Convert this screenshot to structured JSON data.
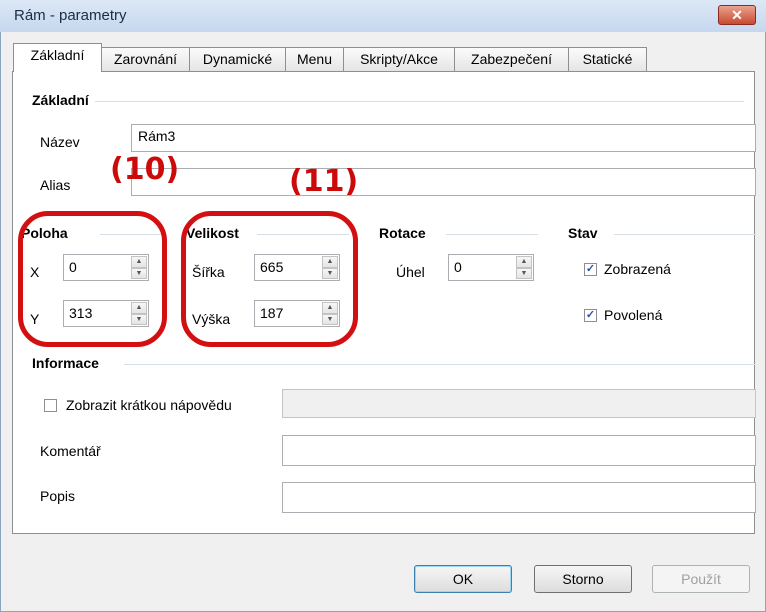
{
  "window": {
    "title": "Rám - parametry",
    "close_label": "✕"
  },
  "tabs": [
    {
      "label": "Základní"
    },
    {
      "label": "Zarovnání"
    },
    {
      "label": "Dynamické"
    },
    {
      "label": "Menu"
    },
    {
      "label": "Skripty/Akce"
    },
    {
      "label": "Zabezpečení"
    },
    {
      "label": "Statické"
    }
  ],
  "basic": {
    "heading": "Základní",
    "name_label": "Název",
    "name_value": "Rám3",
    "alias_label": "Alias",
    "alias_value": ""
  },
  "position": {
    "heading": "Poloha",
    "x_label": "X",
    "x_value": "0",
    "y_label": "Y",
    "y_value": "313"
  },
  "size": {
    "heading": "Velikost",
    "width_label": "Šířka",
    "width_value": "665",
    "height_label": "Výška",
    "height_value": "187"
  },
  "rotation": {
    "heading": "Rotace",
    "angle_label": "Úhel",
    "angle_value": "0"
  },
  "state": {
    "heading": "Stav",
    "visible_label": "Zobrazená",
    "visible_checked": true,
    "enabled_label": "Povolená",
    "enabled_checked": true
  },
  "info": {
    "heading": "Informace",
    "tooltip_label": "Zobrazit krátkou nápovědu",
    "tooltip_checked": false,
    "tooltip_value": "",
    "comment_label": "Komentář",
    "comment_value": "",
    "description_label": "Popis",
    "description_value": ""
  },
  "annotations": {
    "a10": "(10)",
    "a11": "(11)",
    "color": "#d40f12"
  },
  "buttons": {
    "ok": "OK",
    "cancel": "Storno",
    "apply": "Použít"
  },
  "icons": {
    "spin_up": "▲",
    "spin_down": "▼",
    "check": "✓"
  }
}
